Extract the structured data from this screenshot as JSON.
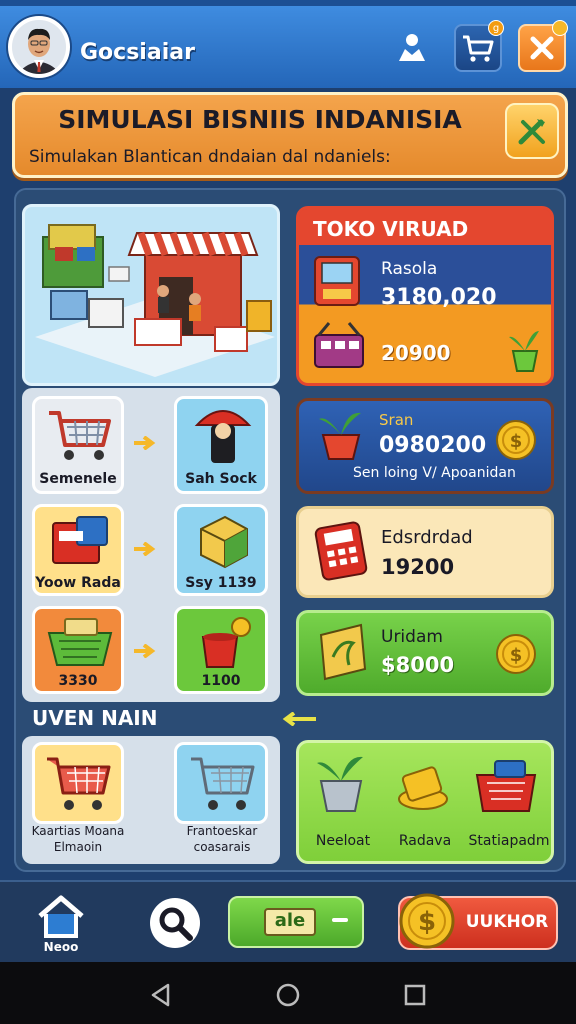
{
  "header": {
    "user_name": "Gocsiaiar",
    "cart_badge": "g"
  },
  "banner": {
    "title": "SIMULASI BISNIIS INDANISIA",
    "subtitle": "Simulakan Blantican dndaian dal ndaniels:"
  },
  "flow_tiles": [
    {
      "label": "Semenele"
    },
    {
      "label": "Sah Sock"
    },
    {
      "label": "Yoow Rada"
    },
    {
      "label": "Ssy 1139"
    },
    {
      "label": "3330"
    },
    {
      "label": "1100"
    }
  ],
  "cards": {
    "toko": {
      "title": "TOKO VIRUAD",
      "label": "Rasola",
      "value1": "3180,020",
      "value2": "20900"
    },
    "stock": {
      "label": "Sran",
      "value": "0980200",
      "caption": "Sen loing V/ Apoanidan"
    },
    "calc": {
      "label": "Edsrdrdad",
      "value": "19200"
    },
    "money": {
      "label": "Uridam",
      "value": "$8000"
    }
  },
  "section": {
    "title": "UVEN NAIN"
  },
  "lower_tiles": [
    {
      "line1": "Kaartias Moana",
      "line2": "Elmaoin"
    },
    {
      "line1": "Frantoeskar",
      "line2": "coasarais"
    }
  ],
  "shop_items": [
    {
      "label": "Neeloat"
    },
    {
      "label": "Radava"
    },
    {
      "label": "Statiapadm"
    }
  ],
  "bottom_bar": {
    "home_label": "Neoo",
    "green_button_label": "ale",
    "red_button_label": "UUKHOR"
  },
  "colors": {
    "header": "#2e78cf",
    "banner": "#ef9a3a",
    "panel": "#2b4c75",
    "green": "#6cc83c",
    "red": "#e2452e",
    "gold": "#f5b82a"
  }
}
